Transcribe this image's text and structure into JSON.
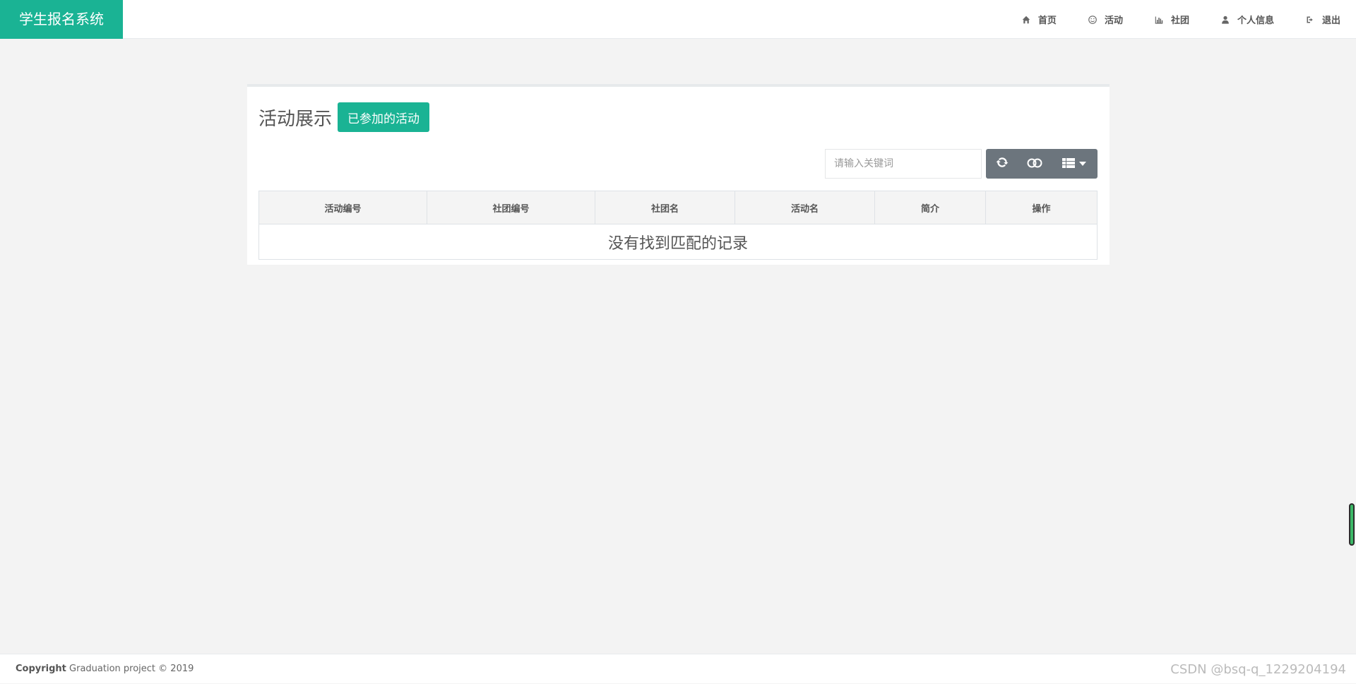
{
  "brand": {
    "title": "学生报名系统"
  },
  "nav": {
    "items": [
      {
        "label": "首页",
        "icon": "home-icon"
      },
      {
        "label": "活动",
        "icon": "smile-icon"
      },
      {
        "label": "社团",
        "icon": "bar-chart-icon"
      },
      {
        "label": "个人信息",
        "icon": "user-icon"
      },
      {
        "label": "退出",
        "icon": "sign-out-icon"
      }
    ]
  },
  "panel": {
    "title": "活动展示",
    "joined_button": "已参加的活动"
  },
  "search": {
    "placeholder": "请输入关键词",
    "value": ""
  },
  "toolbar": {
    "buttons": [
      "refresh-icon",
      "toggle-icon",
      "columns-icon"
    ]
  },
  "table": {
    "columns": [
      "活动编号",
      "社团编号",
      "社团名",
      "活动名",
      "简介",
      "操作"
    ],
    "empty_message": "没有找到匹配的记录"
  },
  "footer": {
    "copyright_label": "Copyright",
    "copyright_text": " Graduation project © 2019"
  },
  "watermark": {
    "text": "CSDN @bsq-q_1229204194"
  },
  "colors": {
    "accent": "#1ab394",
    "toolbar": "#6c757d",
    "background": "#f3f3f3"
  }
}
